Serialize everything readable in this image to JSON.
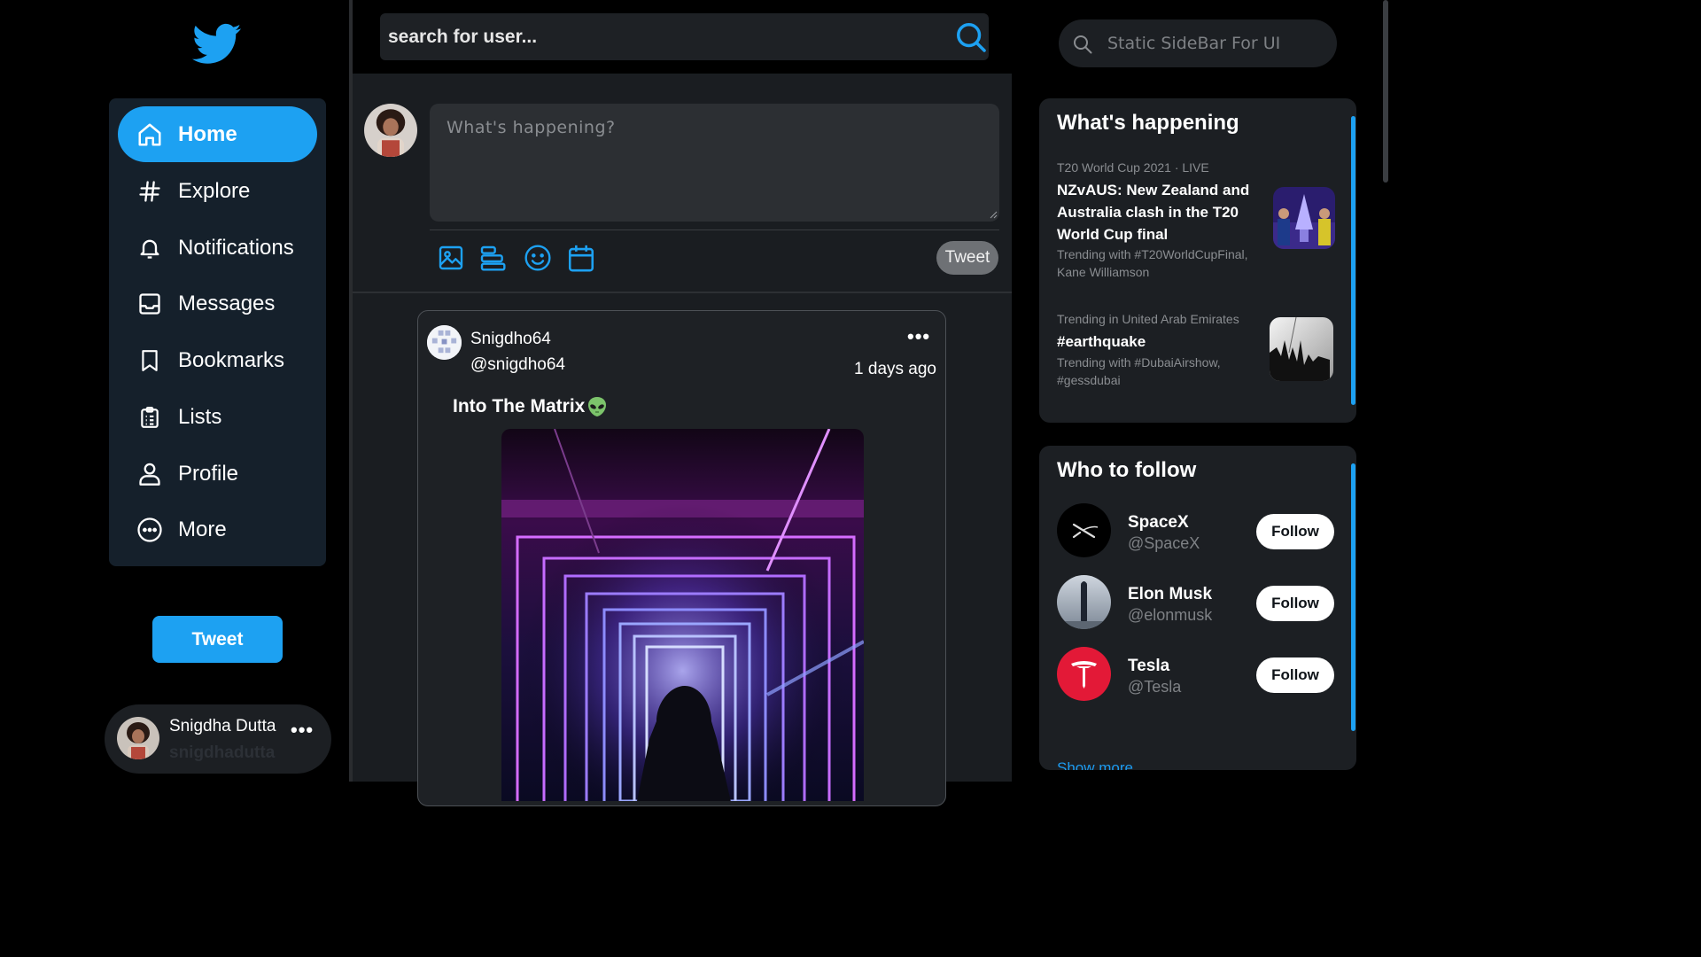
{
  "sidebar": {
    "logo_icon": "twitter-bird-icon",
    "nav": [
      {
        "label": "Home",
        "icon": "home-icon",
        "active": true
      },
      {
        "label": "Explore",
        "icon": "hashtag-icon"
      },
      {
        "label": "Notifications",
        "icon": "bell-icon"
      },
      {
        "label": "Messages",
        "icon": "inbox-icon"
      },
      {
        "label": "Bookmarks",
        "icon": "bookmark-icon"
      },
      {
        "label": "Lists",
        "icon": "clipboard-list-icon"
      },
      {
        "label": "Profile",
        "icon": "user-icon"
      },
      {
        "label": "More",
        "icon": "more-circle-icon"
      }
    ],
    "tweet_button": "Tweet",
    "account": {
      "name": "Snigdha Dutta",
      "handle": "snigdhadutta",
      "more": "•••"
    }
  },
  "search": {
    "placeholder": "search for user..."
  },
  "composer": {
    "placeholder": "What's happening?",
    "tools": [
      "image-icon",
      "poll-icon",
      "emoji-icon",
      "schedule-icon"
    ],
    "tweet_button": "Tweet"
  },
  "post": {
    "author": "Snigdho64",
    "handle": "@snigdho64",
    "more": "•••",
    "time": "1 days ago",
    "text": "Into The Matrix",
    "emoji": "alien-emoji"
  },
  "right_search": {
    "placeholder": "Static SideBar For UI"
  },
  "trends": {
    "title": "What's happening",
    "items": [
      {
        "meta": "T20 World Cup 2021 · LIVE",
        "title": "NZvAUS: New Zealand and Australia clash in the T20 World Cup final",
        "sub": "Trending with #T20WorldCupFinal, Kane Williamson"
      },
      {
        "meta": "Trending in United Arab Emirates",
        "title": "#earthquake",
        "sub": "Trending with #DubaiAirshow, #gessdubai"
      }
    ]
  },
  "follow": {
    "title": "Who to follow",
    "users": [
      {
        "name": "SpaceX",
        "handle": "@SpaceX",
        "button": "Follow"
      },
      {
        "name": "Elon Musk",
        "handle": "@elonmusk",
        "button": "Follow"
      },
      {
        "name": "Tesla",
        "handle": "@Tesla",
        "button": "Follow"
      }
    ],
    "show_more": "Show more"
  },
  "colors": {
    "accent": "#1da1f2",
    "background": "#000000",
    "panel": "#1c1f23",
    "nav_panel": "#15202b"
  }
}
